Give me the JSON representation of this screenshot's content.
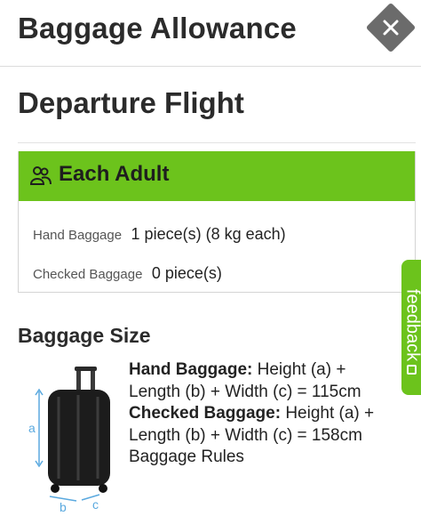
{
  "header": {
    "title": "Baggage Allowance"
  },
  "section": {
    "title": "Departure Flight"
  },
  "passenger_card": {
    "heading": "Each Adult",
    "rows": [
      {
        "label": "Hand Baggage",
        "value": "1 piece(s) (8 kg each)"
      },
      {
        "label": "Checked Baggage",
        "value": "0 piece(s)"
      }
    ]
  },
  "baggage_size": {
    "title": "Baggage Size",
    "hand_label": "Hand Baggage:",
    "hand_text": "Height (a) + Length (b) + Width (c) = 115cm",
    "checked_label": "Checked Baggage:",
    "checked_text": "Height (a) + Length (b) + Width (c) = 158cm",
    "rules_link": "Baggage Rules",
    "diagram_labels": {
      "a": "a",
      "b": "b",
      "c": "c"
    }
  },
  "feedback": {
    "label": "feedback"
  },
  "colors": {
    "accent_green": "#6cc31c",
    "close_gray": "#6b6b6b",
    "dimension_blue": "#5aa9df"
  },
  "icons": {
    "close": "close-x-icon",
    "passenger": "passenger-group-icon",
    "feedback": "feedback-box-icon"
  }
}
